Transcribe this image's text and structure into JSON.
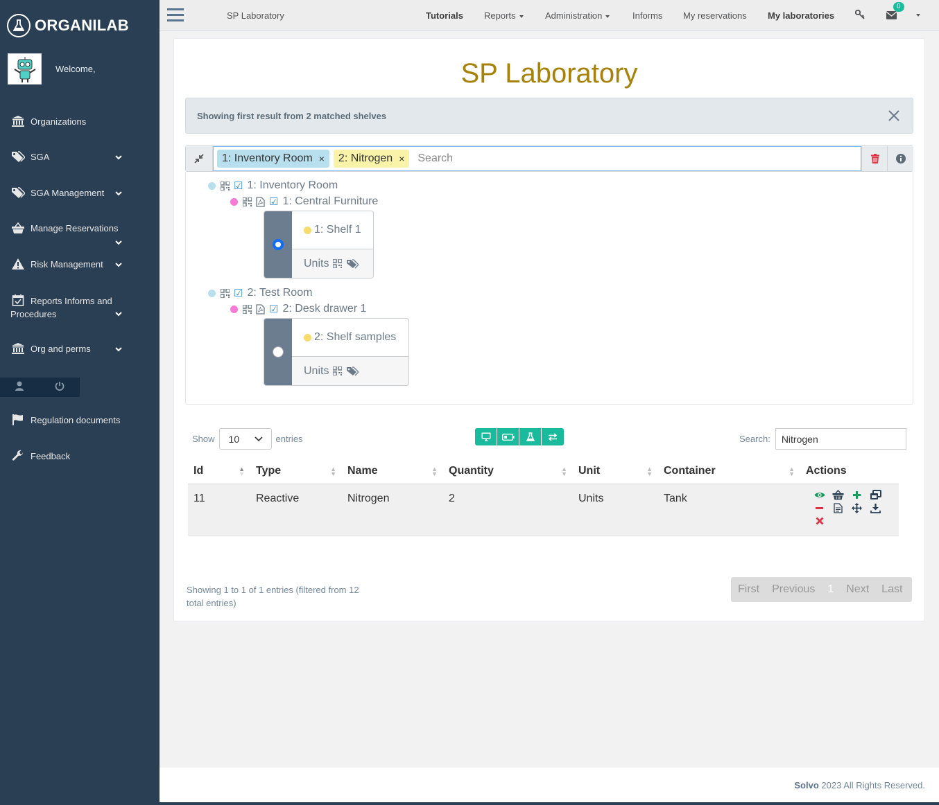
{
  "brand": {
    "name": "ORGANILAB"
  },
  "sidebar": {
    "welcome": "Welcome,",
    "items": [
      {
        "label": "Organizations",
        "icon": "institution-icon"
      },
      {
        "label": "SGA",
        "icon": "tags-icon"
      },
      {
        "label": "SGA Management",
        "icon": "tags-icon"
      },
      {
        "label": "Manage Reservations",
        "icon": "basket-icon"
      },
      {
        "label": "Risk Management",
        "icon": "warning-icon"
      },
      {
        "label": "Reports Informs and Procedures",
        "icon": "calendar-check-icon"
      },
      {
        "label": "Org and perms",
        "icon": "institution-icon"
      },
      {
        "label": "Regulation documents",
        "icon": "flag-icon"
      },
      {
        "label": "Feedback",
        "icon": "wrench-icon"
      }
    ]
  },
  "topnav": {
    "breadcrumb": "SP Laboratory",
    "items": [
      "Tutorials",
      "Reports",
      "Administration",
      "Informs",
      "My reservations",
      "My laboratories"
    ],
    "mail_count": "0"
  },
  "page": {
    "title": "SP Laboratory"
  },
  "alert": {
    "text": "Showing first result from 2 matched shelves"
  },
  "search": {
    "tags": [
      {
        "label": "1: Inventory Room",
        "color": "#b7dfee"
      },
      {
        "label": "2: Nitrogen",
        "color": "#f8f3a9"
      }
    ],
    "placeholder": "Search"
  },
  "tree": {
    "rooms": [
      {
        "label": "1: Inventory Room",
        "furniture": "1: Central Furniture",
        "shelf": "1: Shelf 1",
        "selected": true
      },
      {
        "label": "2: Test Room",
        "furniture": "2: Desk drawer 1",
        "shelf": "2: Shelf samples",
        "selected": false
      }
    ],
    "units_label": "Units"
  },
  "table_controls": {
    "show": "Show",
    "entries": "entries",
    "page_length": "10",
    "search_label": "Search:",
    "search_value": "Nitrogen"
  },
  "table": {
    "headers": [
      "Id",
      "Type",
      "Name",
      "Quantity",
      "Unit",
      "Container",
      "Actions"
    ],
    "rows": [
      {
        "id": "11",
        "type": "Reactive",
        "name": "Nitrogen",
        "quantity": "2",
        "unit": "Units",
        "container": "Tank"
      }
    ]
  },
  "pagination": {
    "info": "Showing 1 to 1 of 1 entries (filtered from 12 total entries)",
    "first": "First",
    "previous": "Previous",
    "current": "1",
    "next": "Next",
    "last": "Last"
  },
  "footer": {
    "company": "Solvo",
    "text": " 2023 All Rights Reserved."
  },
  "colors": {
    "sidebar": "#2a3f54",
    "accent": "#1abb9c",
    "title": "#a7820a"
  }
}
